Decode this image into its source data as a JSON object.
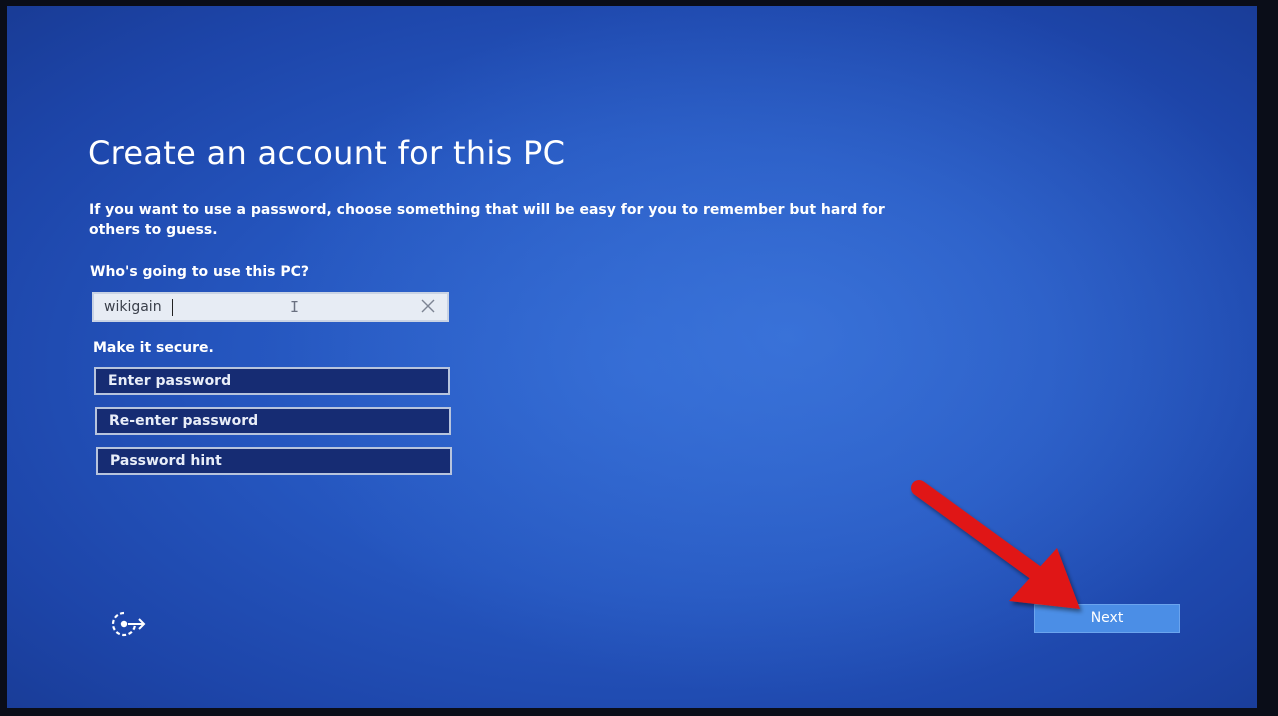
{
  "setup": {
    "title": "Create an account for this PC",
    "description": "If you want to use a password, choose something that will be easy for you to remember but hard for others to guess.",
    "who_label": "Who's going to use this PC?",
    "username_value": "wikigain",
    "secure_label": "Make it secure.",
    "password_placeholder": "Enter password",
    "reenter_placeholder": "Re-enter password",
    "hint_placeholder": "Password hint",
    "next_label": "Next"
  },
  "icons": {
    "accessibility": "ease-of-access-icon",
    "clear": "clear-x-icon",
    "annotation": "red-arrow-icon"
  },
  "colors": {
    "background": "#2556bf",
    "field_dark": "#162c73",
    "next_button": "#4b8ee6",
    "arrow": "#e01818"
  }
}
